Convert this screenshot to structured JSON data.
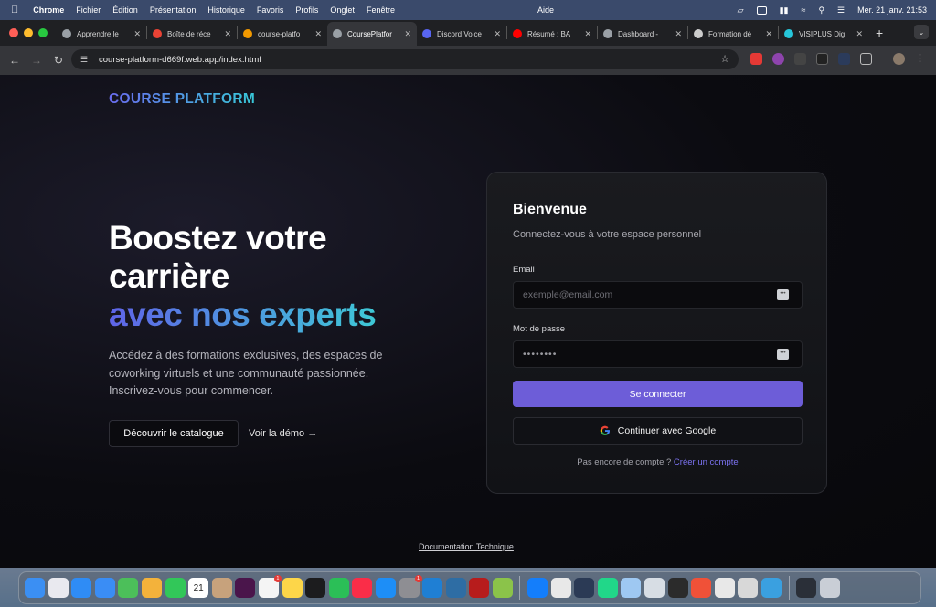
{
  "menubar": {
    "app": "Chrome",
    "items": [
      "Fichier",
      "Édition",
      "Présentation",
      "Historique",
      "Favoris",
      "Profils",
      "Onglet",
      "Fenêtre"
    ],
    "help": "Aide",
    "clock": "Mer. 21 janv.  21:53"
  },
  "tabs": [
    {
      "label": "Apprendre le",
      "color": "#9aa0a6"
    },
    {
      "label": "Boîte de réce",
      "color": "#ea4335"
    },
    {
      "label": "course-platfo",
      "color": "#f29900"
    },
    {
      "label": "CoursePlatfor",
      "color": "#9aa0a6",
      "active": true
    },
    {
      "label": "Discord Voice",
      "color": "#5865f2"
    },
    {
      "label": "Résumé : BA",
      "color": "#ff0000"
    },
    {
      "label": "Dashboard -",
      "color": "#9aa0a6"
    },
    {
      "label": "Formation dé",
      "color": "#cccccc"
    },
    {
      "label": "VISIPLUS Dig",
      "color": "#26c6da"
    }
  ],
  "address": {
    "url": "course-platform-d669f.web.app/index.html"
  },
  "page": {
    "logo": "COURSE PLATFORM",
    "hero_line1": "Boostez votre",
    "hero_line2": "carrière",
    "hero_accent": "avec nos experts",
    "hero_sub": "Accédez à des formations exclusives, des espaces de coworking virtuels et une communauté passionnée. Inscrivez-vous pour commencer.",
    "catalog_button": "Découvrir le catalogue",
    "demo_link": "Voir la démo →",
    "doc_link": "Documentation Technique"
  },
  "login": {
    "title": "Bienvenue",
    "subtitle": "Connectez-vous à votre espace personnel",
    "email_label": "Email",
    "email_placeholder": "exemple@email.com",
    "password_label": "Mot de passe",
    "password_value": "••••••••",
    "submit": "Se connecter",
    "google": "Continuer avec Google",
    "signup_prompt": "Pas encore de compte ?",
    "signup_link": "Créer un compte"
  },
  "dock": {
    "apps": [
      {
        "name": "finder",
        "color": "#3b8ff3"
      },
      {
        "name": "launchpad",
        "color": "#e9e9ef"
      },
      {
        "name": "safari",
        "color": "#2f8cf5"
      },
      {
        "name": "mail",
        "color": "#3a8df5"
      },
      {
        "name": "maps",
        "color": "#4cbf5a"
      },
      {
        "name": "photos",
        "color": "#f3b23b"
      },
      {
        "name": "facetime",
        "color": "#32c759"
      },
      {
        "name": "calendar",
        "color": "#ffffff",
        "text": "21"
      },
      {
        "name": "contacts",
        "color": "#c7a27c"
      },
      {
        "name": "slack",
        "color": "#4a154b"
      },
      {
        "name": "reminders",
        "color": "#f4f4f4",
        "badge": "1"
      },
      {
        "name": "notes",
        "color": "#fdd649"
      },
      {
        "name": "tv",
        "color": "#1c1c1e"
      },
      {
        "name": "numbers",
        "color": "#2bbf57"
      },
      {
        "name": "music",
        "color": "#fa2d48"
      },
      {
        "name": "app-store",
        "color": "#1d8ef7"
      },
      {
        "name": "settings",
        "color": "#8e8e93",
        "badge": "1"
      },
      {
        "name": "vscode",
        "color": "#1f7fd4"
      },
      {
        "name": "mysql-workbench",
        "color": "#2e6da4"
      },
      {
        "name": "pixelmator",
        "color": "#b71c1c"
      },
      {
        "name": "colors",
        "color": "#8bc34a"
      },
      {
        "name": "xcode",
        "color": "#147efb"
      },
      {
        "name": "chrome",
        "color": "#e8e8e8"
      },
      {
        "name": "android-studio",
        "color": "#2b3a55"
      },
      {
        "name": "pycharm",
        "color": "#21d789"
      },
      {
        "name": "preview",
        "color": "#9ec8f2"
      },
      {
        "name": "disk-utility",
        "color": "#d7dde4"
      },
      {
        "name": "terminal",
        "color": "#2b2b2b"
      },
      {
        "name": "swift-playgrounds",
        "color": "#f05138"
      },
      {
        "name": "chrome-2",
        "color": "#e8e8e8"
      },
      {
        "name": "calculator",
        "color": "#d8d8d8"
      },
      {
        "name": "quicktime",
        "color": "#3aa0e0"
      },
      {
        "name": "minimized-window",
        "color": "#2a2f38"
      },
      {
        "name": "trash",
        "color": "#c9ced6"
      }
    ]
  }
}
